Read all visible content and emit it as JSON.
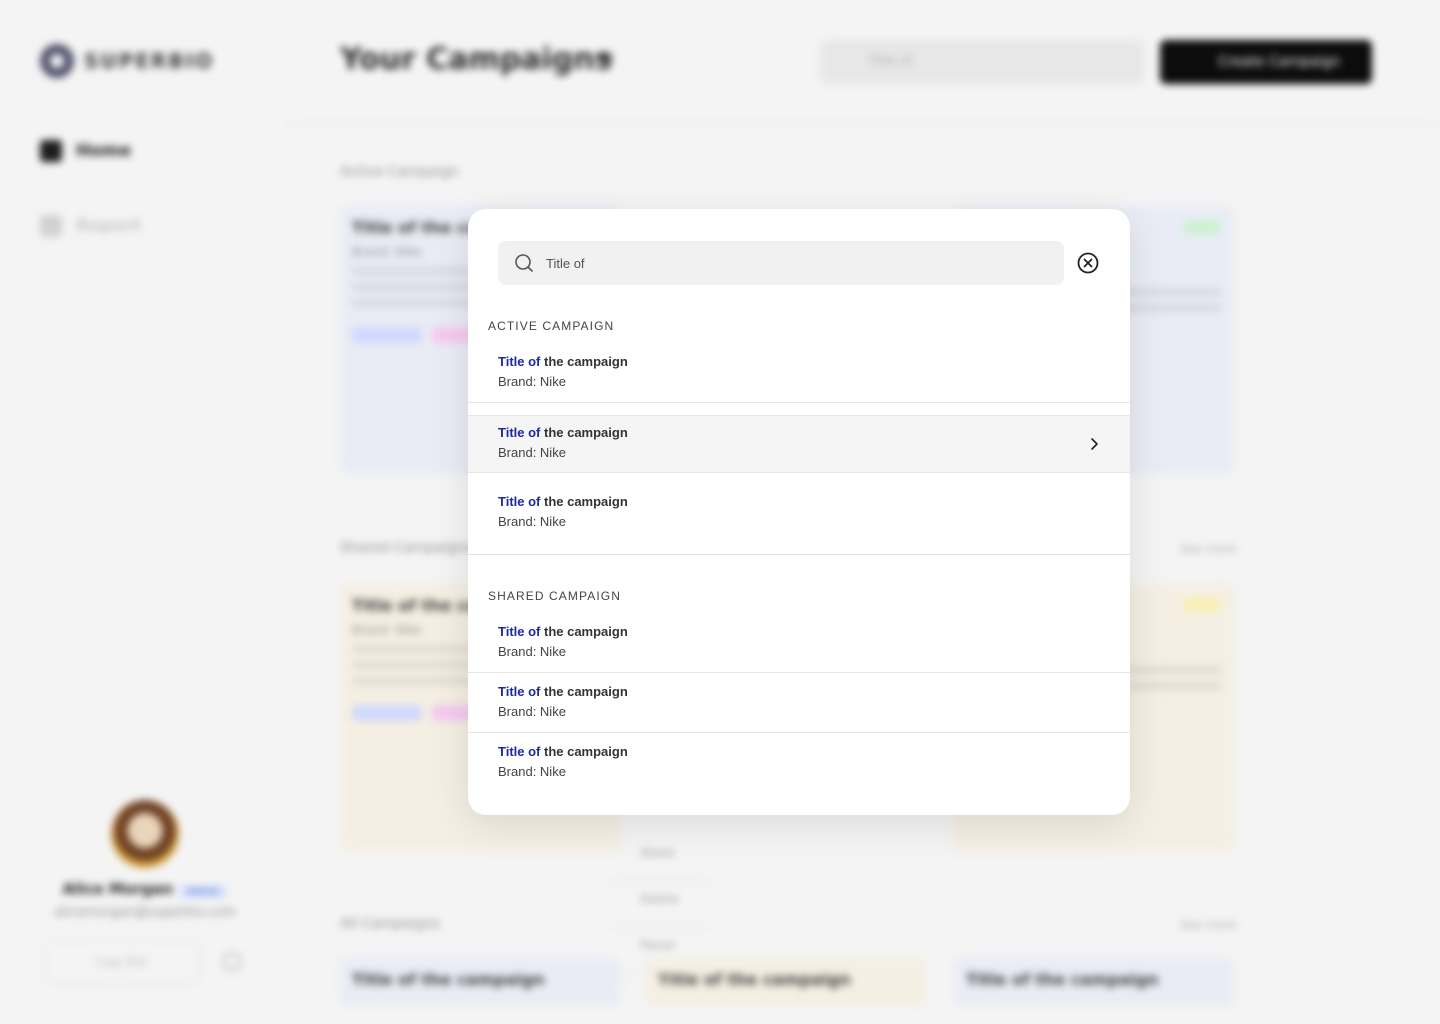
{
  "background": {
    "logo_text": "SUPERBIO",
    "nav": [
      {
        "label": "Home"
      },
      {
        "label": "Report"
      }
    ],
    "page_title": "Your Campaigns",
    "search_value": "Title of",
    "create_button": "Create Campaign",
    "sections": {
      "active": "Active Campaign",
      "shared": "Shared Campaigns",
      "all": "All Campaigns",
      "see_more": "See more"
    },
    "card_title": "Title of the campaign",
    "card_brand": "Brand: Nike",
    "profile": {
      "name": "Alice Morgan",
      "badge": "Admin",
      "email": "alicemorgan@superbio.com"
    },
    "logout": "Log Out",
    "context_menu": [
      "Share",
      "Delete",
      "Pause"
    ]
  },
  "modal": {
    "search": {
      "value": "Title of",
      "placeholder": "Search"
    },
    "groups": [
      {
        "label": "ACTIVE CAMPAIGN",
        "results": [
          {
            "highlight": "Title of",
            "rest": " the campaign",
            "brand": "Brand: Nike"
          },
          {
            "highlight": "Title of",
            "rest": " the campaign",
            "brand": "Brand: Nike"
          },
          {
            "highlight": "Title of",
            "rest": " the campaign",
            "brand": "Brand: Nike"
          }
        ]
      },
      {
        "label": "SHARED CAMPAIGN",
        "results": [
          {
            "highlight": "Title of",
            "rest": " the campaign",
            "brand": "Brand: Nike"
          },
          {
            "highlight": "Title of",
            "rest": " the campaign",
            "brand": "Brand: Nike"
          },
          {
            "highlight": "Title of",
            "rest": " the campaign",
            "brand": "Brand: Nike"
          }
        ]
      }
    ]
  },
  "colors": {
    "highlight": "#1d2a9e",
    "hover_row": "#f5f5f5",
    "backdrop": "#f4f4f4"
  }
}
